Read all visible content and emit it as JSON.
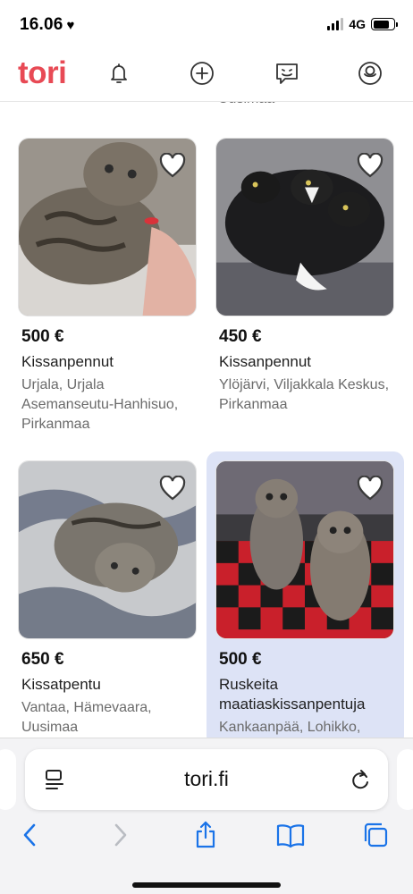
{
  "status": {
    "time": "16.06",
    "network": "4G"
  },
  "header": {
    "logo": "tori",
    "icons": [
      "bell-icon",
      "plus-circle-icon",
      "messages-icon",
      "profile-icon"
    ],
    "brand_color": "#e84a55"
  },
  "previous_location_fragment": "Uusimaa",
  "listings": [
    {
      "price": "500 €",
      "title": "Kissanpennut",
      "location": "Urjala, Urjala Asemanseutu-Hanhisuo, Pirkanmaa",
      "highlighted": false
    },
    {
      "price": "450 €",
      "title": "Kissanpennut",
      "location": "Ylöjärvi, Viljakkala Keskus, Pirkanmaa",
      "highlighted": false
    },
    {
      "price": "650 €",
      "title": "Kissatpentu",
      "location": "Vantaa, Hämevaara, Uusimaa",
      "highlighted": false
    },
    {
      "price": "500 €",
      "title": "Ruskeita maatiaskissanpentuja",
      "location": "Kankaanpää, Lohikko,",
      "highlighted": true
    }
  ],
  "browser": {
    "url": "tori.fi",
    "toolbar": [
      "back-icon",
      "forward-icon",
      "share-icon",
      "bookmarks-icon",
      "tabs-icon"
    ],
    "accent": "#1a73e8"
  }
}
